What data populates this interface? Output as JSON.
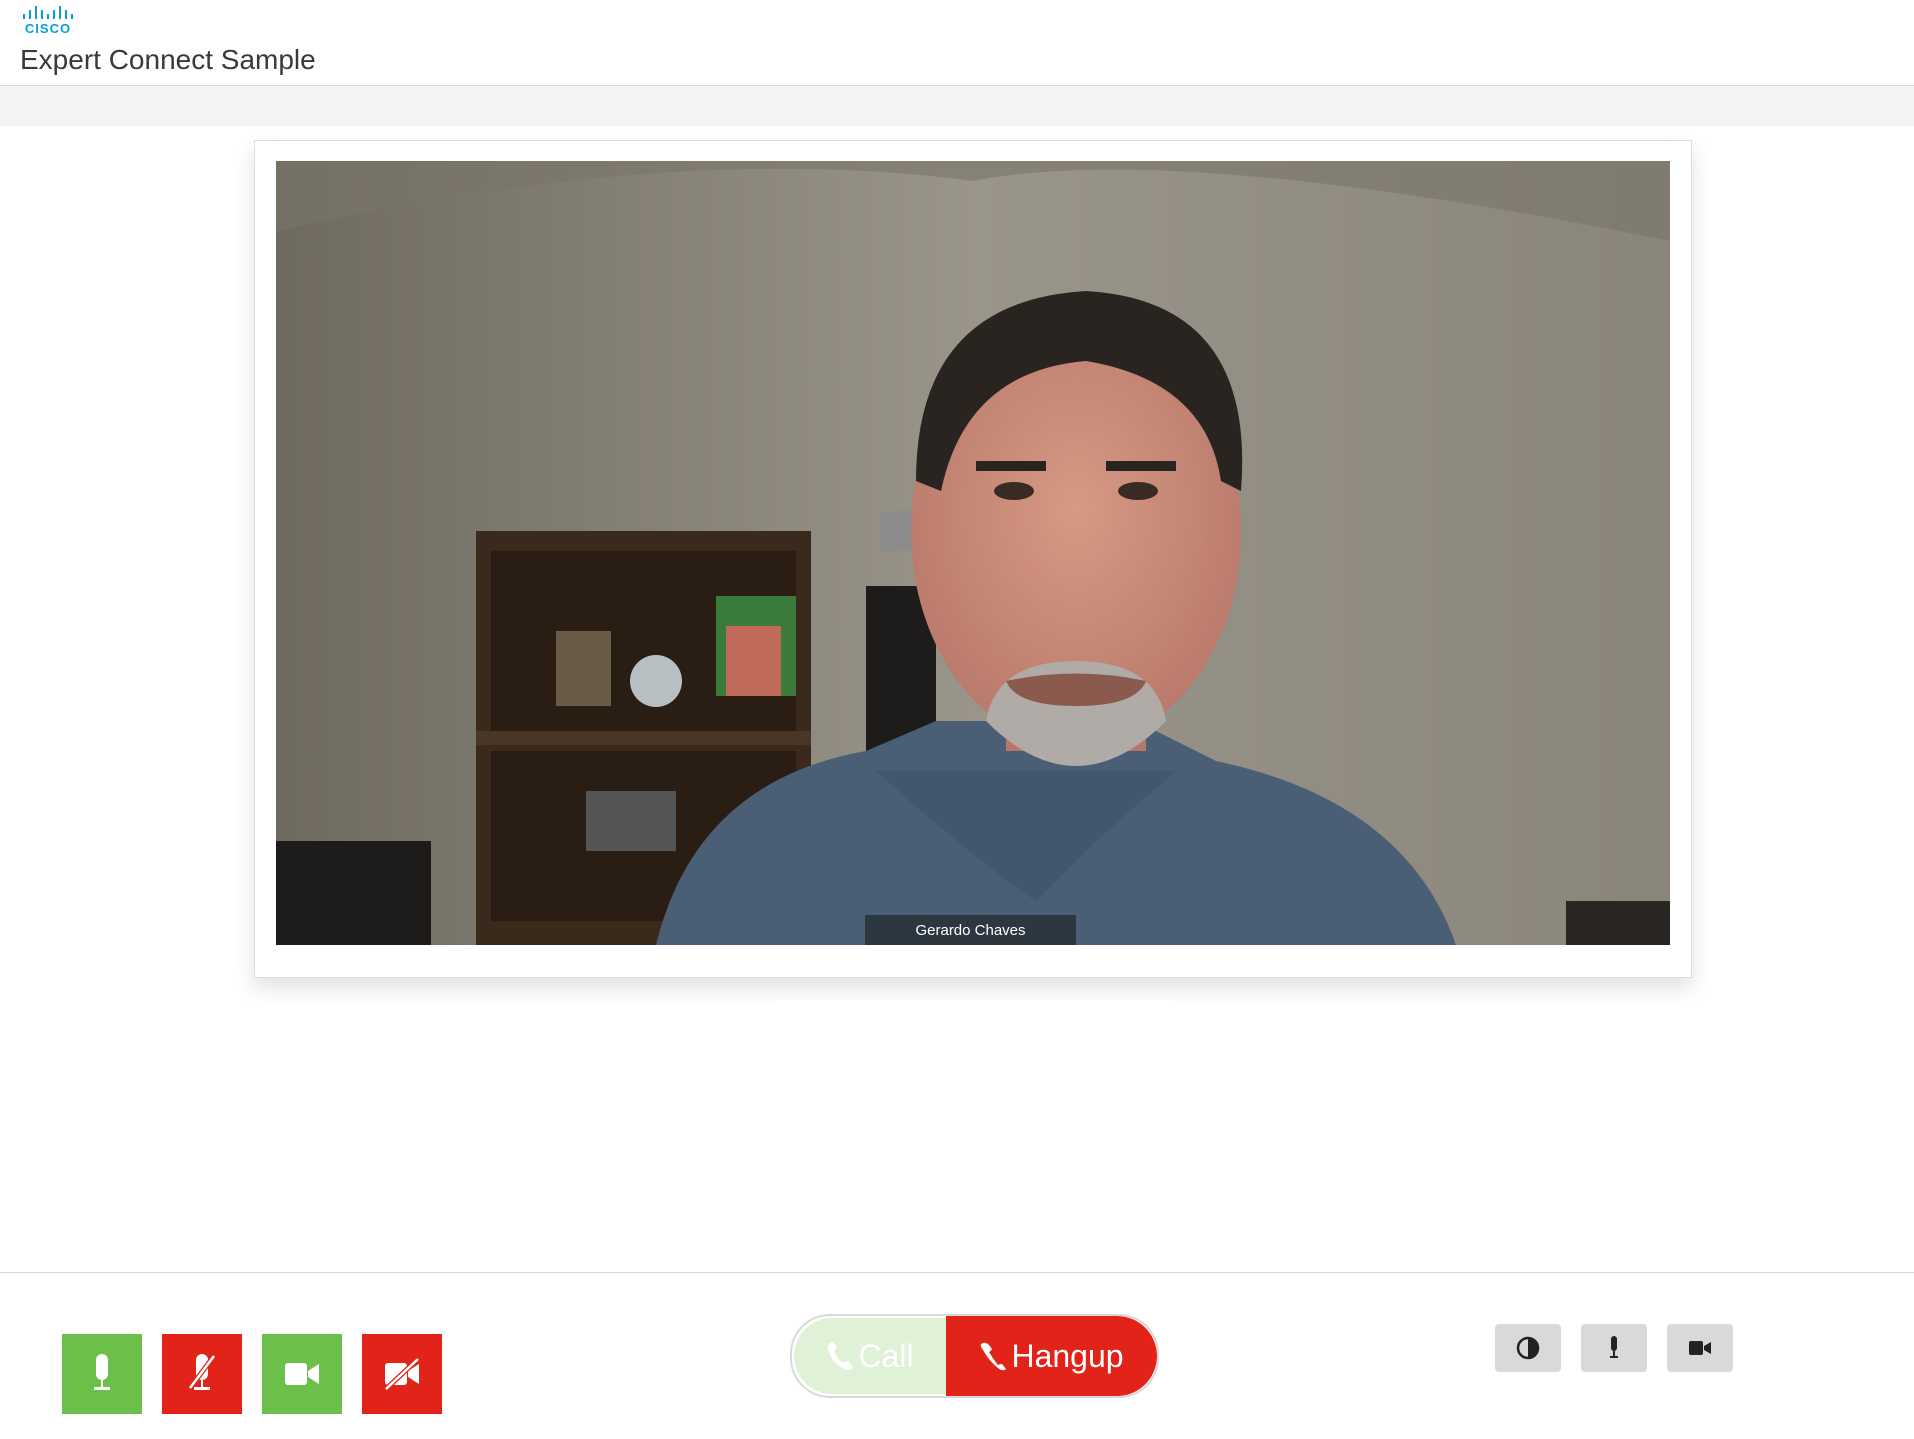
{
  "header": {
    "logo_text": "CISCO",
    "title": "Expert Connect Sample"
  },
  "video": {
    "participant_name": "Gerardo Chaves"
  },
  "controls": {
    "mic_on_icon": "microphone-icon",
    "mic_off_icon": "microphone-muted-icon",
    "camera_on_icon": "video-camera-icon",
    "camera_off_icon": "video-camera-off-icon"
  },
  "call": {
    "call_label": "Call",
    "hangup_label": "Hangup"
  },
  "colors": {
    "green": "#6cc04a",
    "red": "#e2231a",
    "call_disabled": "#dff1d6",
    "cisco_blue": "#049fd9"
  }
}
